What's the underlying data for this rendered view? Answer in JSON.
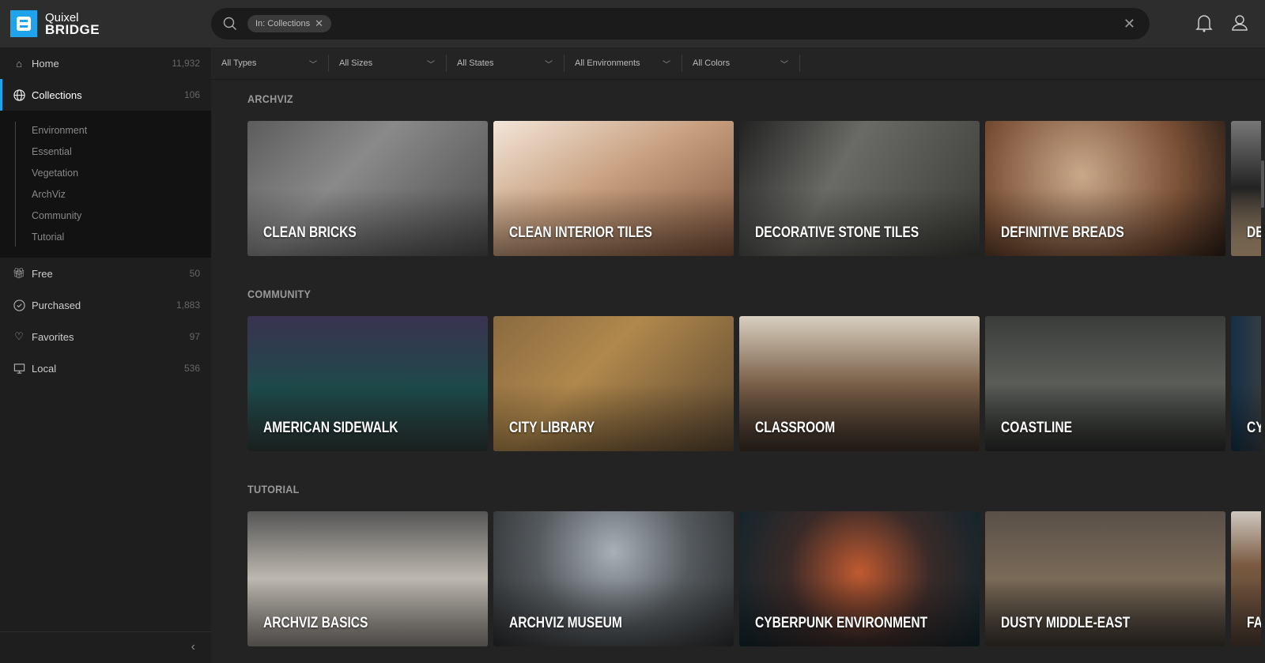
{
  "app": {
    "logo_line1": "Quixel",
    "logo_line2": "BRIDGE"
  },
  "search": {
    "chip": "In: Collections"
  },
  "sidebar": {
    "items_top": [
      {
        "label": "Home",
        "count": "11,932",
        "icon": "home-icon"
      },
      {
        "label": "Collections",
        "count": "106",
        "icon": "globe-icon"
      }
    ],
    "sub_items": [
      "Environment",
      "Essential",
      "Vegetation",
      "ArchViz",
      "Community",
      "Tutorial"
    ],
    "items_bottom": [
      {
        "label": "Free",
        "count": "50",
        "icon": "gift-icon"
      },
      {
        "label": "Purchased",
        "count": "1,883",
        "icon": "check-circle-icon"
      },
      {
        "label": "Favorites",
        "count": "97",
        "icon": "heart-icon"
      },
      {
        "label": "Local",
        "count": "536",
        "icon": "monitor-icon"
      }
    ]
  },
  "filters": [
    "All Types",
    "All Sizes",
    "All States",
    "All Environments",
    "All Colors"
  ],
  "sections": [
    {
      "title": "ARCHVIZ",
      "cards": [
        {
          "title": "CLEAN BRICKS",
          "bg": "linear-gradient(135deg,#5c5c5c,#8a8a8a 40%,#4a4a4a)"
        },
        {
          "title": "CLEAN INTERIOR TILES",
          "bg": "linear-gradient(150deg,#f3e6d8,#c8a080 45%,#7a5038)"
        },
        {
          "title": "DECORATIVE STONE TILES",
          "bg": "linear-gradient(120deg,#222,#6a6a66 40%,#3a3a36)"
        },
        {
          "title": "DEFINITIVE BREADS",
          "bg": "radial-gradient(circle at 40% 40%,#c9a88a,#7a5036 60%,#2a1d16)"
        },
        {
          "title": "DE",
          "bg": "linear-gradient(180deg,#777,#222 50%,#d9b890)"
        }
      ]
    },
    {
      "title": "COMMUNITY",
      "cards": [
        {
          "title": "AMERICAN SIDEWALK",
          "bg": "linear-gradient(180deg,#3a3350,#1d4a4a 55%,#2e3a38)"
        },
        {
          "title": "CITY LIBRARY",
          "bg": "linear-gradient(135deg,#8a6a40,#b0884c 40%,#5a4630)"
        },
        {
          "title": "CLASSROOM",
          "bg": "linear-gradient(180deg,#d8cfc0,#7a6048 50%,#3a2e26)"
        },
        {
          "title": "COASTLINE",
          "bg": "linear-gradient(180deg,#3a3d3a,#5a5d58 50%,#2a2c2a)"
        },
        {
          "title": "CY",
          "bg": "linear-gradient(90deg,#123048,#a06030 50%,#102030)"
        }
      ]
    },
    {
      "title": "TUTORIAL",
      "cards": [
        {
          "title": "ARCHVIZ BASICS",
          "bg": "linear-gradient(180deg,#555,#bdb8b0 50%,#8a8580)"
        },
        {
          "title": "ARCHVIZ MUSEUM",
          "bg": "radial-gradient(circle at 50% 30%,#a8b0b8,#555a5e 50%,#2a2c2e)"
        },
        {
          "title": "CYBERPUNK ENVIRONMENT",
          "bg": "radial-gradient(circle at 50% 45%,#c05a30,#3a2a28 50%,#10242c)"
        },
        {
          "title": "DUSTY MIDDLE-EAST",
          "bg": "linear-gradient(180deg,#5a5048,#7a6a58 50%,#3a342e)"
        },
        {
          "title": "FA",
          "bg": "linear-gradient(180deg,#cfc8c0,#7a5a40 40%,#4a3a30)"
        }
      ]
    }
  ]
}
